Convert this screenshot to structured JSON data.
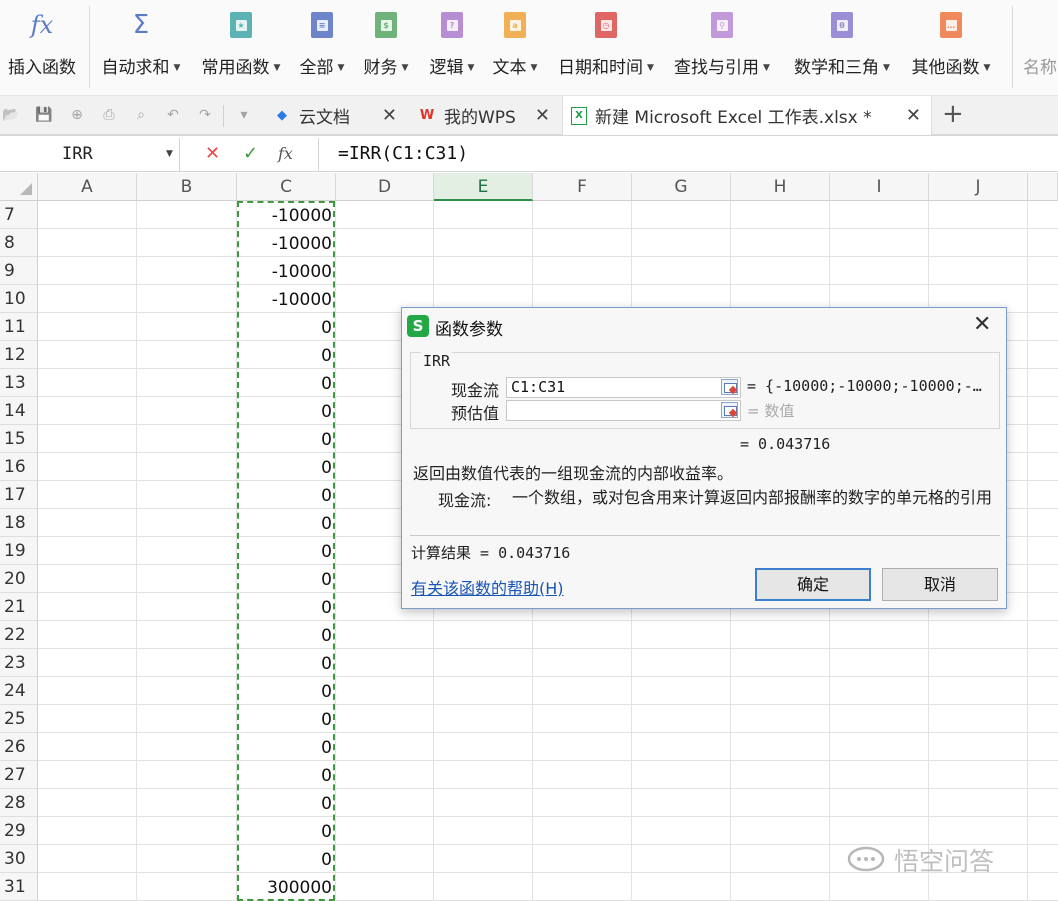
{
  "ribbon": {
    "items": [
      {
        "label": "插入函数",
        "icon": "fx-icon",
        "glyph": "fx",
        "color": "#5a7bc8",
        "dropdown": false
      },
      {
        "label": "自动求和",
        "icon": "sigma-icon",
        "glyph": "Σ",
        "color": "#5a7bc8",
        "dropdown": true
      },
      {
        "label": "常用函数",
        "icon": "star-book-icon",
        "glyph": "★",
        "color": "#5bb3b3",
        "dropdown": true
      },
      {
        "label": "全部",
        "icon": "list-book-icon",
        "glyph": "≡",
        "color": "#6c86c9",
        "dropdown": true
      },
      {
        "label": "财务",
        "icon": "finance-book-icon",
        "glyph": "$",
        "color": "#6fb27a",
        "dropdown": true
      },
      {
        "label": "逻辑",
        "icon": "logic-book-icon",
        "glyph": "?",
        "color": "#b78ed3",
        "dropdown": true
      },
      {
        "label": "文本",
        "icon": "text-book-icon",
        "glyph": "a",
        "color": "#f1b055",
        "dropdown": true
      },
      {
        "label": "日期和时间",
        "icon": "clock-book-icon",
        "glyph": "◷",
        "color": "#e06666",
        "dropdown": true
      },
      {
        "label": "查找与引用",
        "icon": "search-book-icon",
        "glyph": "⚲",
        "color": "#c39ad9",
        "dropdown": true
      },
      {
        "label": "数学和三角",
        "icon": "math-book-icon",
        "glyph": "θ",
        "color": "#9b8ed6",
        "dropdown": true
      },
      {
        "label": "其他函数",
        "icon": "more-book-icon",
        "glyph": "…",
        "color": "#f08a5d",
        "dropdown": true
      },
      {
        "label": "名称",
        "icon": "",
        "glyph": "",
        "color": "#999999",
        "dropdown": false
      }
    ]
  },
  "tabs": [
    {
      "label": "云文档",
      "icon": "cloud-cube-icon",
      "color": "#2c7be5"
    },
    {
      "label": "我的WPS",
      "icon": "wps-logo-icon",
      "color": "#e0322b"
    },
    {
      "label": "新建 Microsoft Excel 工作表.xlsx *",
      "icon": "excel-file-icon",
      "color": "#1f9d45"
    }
  ],
  "new_tab": "+",
  "formula_bar": {
    "name_box": "IRR",
    "cancel": "✕",
    "confirm": "✓",
    "insert": "fx",
    "formula": "=IRR(C1:C31)"
  },
  "grid": {
    "columns": [
      "A",
      "B",
      "C",
      "D",
      "E",
      "F",
      "G",
      "H",
      "I",
      "J"
    ],
    "selected_column": "E",
    "rows": [
      {
        "row": "7",
        "c": "-10000"
      },
      {
        "row": "8",
        "c": "-10000"
      },
      {
        "row": "9",
        "c": "-10000"
      },
      {
        "row": "10",
        "c": "-10000"
      },
      {
        "row": "11",
        "c": "0"
      },
      {
        "row": "12",
        "c": "0"
      },
      {
        "row": "13",
        "c": "0"
      },
      {
        "row": "14",
        "c": "0"
      },
      {
        "row": "15",
        "c": "0"
      },
      {
        "row": "16",
        "c": "0"
      },
      {
        "row": "17",
        "c": "0"
      },
      {
        "row": "18",
        "c": "0"
      },
      {
        "row": "19",
        "c": "0"
      },
      {
        "row": "20",
        "c": "0"
      },
      {
        "row": "21",
        "c": "0"
      },
      {
        "row": "22",
        "c": "0"
      },
      {
        "row": "23",
        "c": "0"
      },
      {
        "row": "24",
        "c": "0"
      },
      {
        "row": "25",
        "c": "0"
      },
      {
        "row": "26",
        "c": "0"
      },
      {
        "row": "27",
        "c": "0"
      },
      {
        "row": "28",
        "c": "0"
      },
      {
        "row": "29",
        "c": "0"
      },
      {
        "row": "30",
        "c": "0"
      },
      {
        "row": "31",
        "c": "300000"
      }
    ]
  },
  "dialog": {
    "title": "函数参数",
    "close": "✕",
    "function_name": "IRR",
    "args": [
      {
        "label": "现金流",
        "value": "C1:C31",
        "result": "= {-10000;-10000;-10000;-…",
        "placeholder": false
      },
      {
        "label": "预估值",
        "value": "",
        "result": "= 数值",
        "placeholder": true
      }
    ],
    "formula_result": "= 0.043716",
    "description": "返回由数值代表的一组现金流的内部收益率。",
    "arg_help_name": "现金流:",
    "arg_help_text": "一个数组，或对包含用来计算返回内部报酬率的数字的单元格的引用",
    "calc_result": "计算结果 = 0.043716",
    "help_link": "有关该函数的帮助(H)",
    "ok": "确定",
    "cancel": "取消"
  },
  "watermark": "悟空问答"
}
